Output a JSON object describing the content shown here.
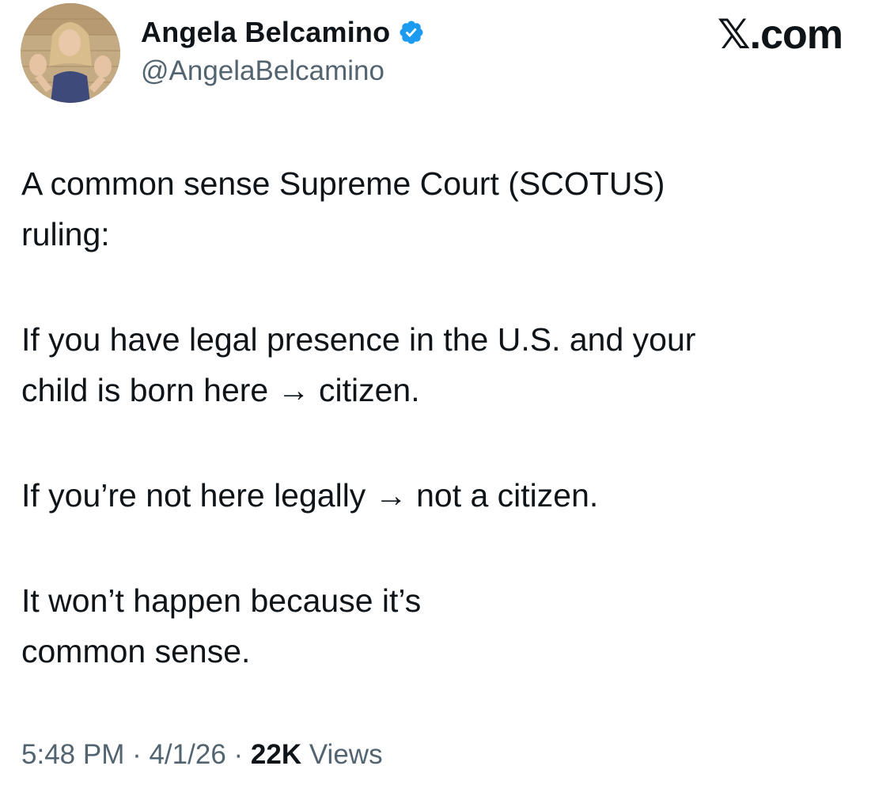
{
  "author": {
    "display_name": "Angela Belcamino",
    "handle": "@AngelaBelcamino",
    "verified": true,
    "avatar_icon": "profile-photo"
  },
  "brand": {
    "label": "𝕏.com"
  },
  "tweet": {
    "paragraphs": [
      "A common sense Supreme Court (SCOTUS)\nruling:",
      "If you have legal presence in the U.S. and your\nchild is born here → citizen.",
      "If you’re not here legally → not a citizen.",
      "It won’t happen because it’s\ncommon sense."
    ]
  },
  "meta": {
    "time": "5:48 PM",
    "separator": " · ",
    "date": "4/1/26",
    "views_count": "22K",
    "views_label": "Views"
  },
  "colors": {
    "text": "#0f1419",
    "secondary": "#536471",
    "verified_badge": "#1d9bf0"
  }
}
